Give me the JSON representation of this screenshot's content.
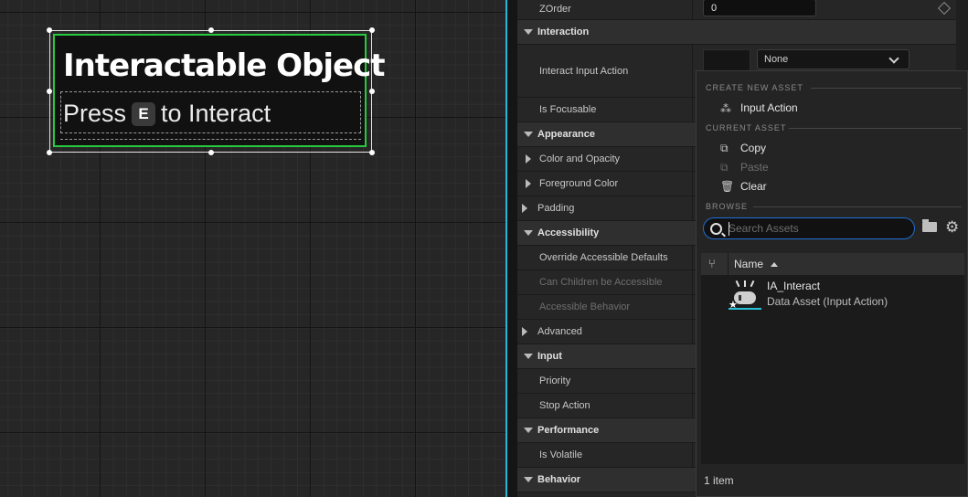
{
  "canvas": {
    "widget": {
      "title": "Interactable Object",
      "prompt_prefix": "Press",
      "prompt_key": "E",
      "prompt_suffix": "to Interact"
    },
    "colors": {
      "selection_outline": "#27c93f",
      "divider": "#27b6d6"
    }
  },
  "details": {
    "zorder": {
      "label": "ZOrder",
      "value": "0"
    },
    "interaction": {
      "label": "Interaction",
      "interact_input_action": {
        "label": "Interact Input Action",
        "value": "None"
      },
      "is_focusable": "Is Focusable"
    },
    "appearance": {
      "label": "Appearance",
      "color_and_opacity": "Color and Opacity",
      "foreground_color": "Foreground Color",
      "padding": "Padding"
    },
    "accessibility": {
      "label": "Accessibility",
      "override_defaults": "Override Accessible Defaults",
      "children_accessible": "Can Children be Accessible",
      "accessible_behavior": "Accessible Behavior",
      "advanced": "Advanced"
    },
    "input": {
      "label": "Input",
      "priority": "Priority",
      "stop_action": "Stop Action"
    },
    "performance": {
      "label": "Performance",
      "is_volatile": "Is Volatile"
    },
    "behavior": {
      "label": "Behavior"
    }
  },
  "popup": {
    "create_new_asset": "CREATE NEW ASSET",
    "input_action": "Input Action",
    "current_asset": "CURRENT ASSET",
    "copy": "Copy",
    "paste": "Paste",
    "clear": "Clear",
    "browse": "BROWSE",
    "search_placeholder": "Search Assets",
    "column_name": "Name",
    "assets": [
      {
        "name": "IA_Interact",
        "type": "Data Asset (Input Action)"
      }
    ],
    "item_count": "1 item",
    "colors": {
      "search_border": "#1f6fd6",
      "asset_underline": "#27c0d8"
    }
  }
}
